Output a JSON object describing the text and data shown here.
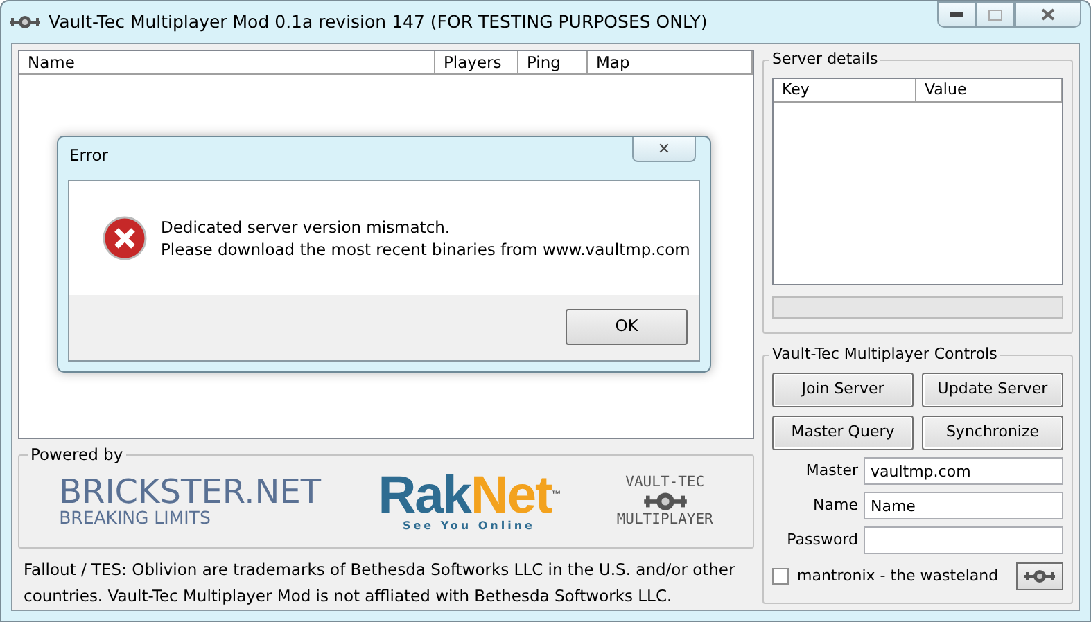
{
  "window": {
    "title": "Vault-Tec Multiplayer Mod 0.1a revision 147 (FOR TESTING PURPOSES ONLY)"
  },
  "server_list": {
    "columns": [
      "Name",
      "Players",
      "Ping",
      "Map"
    ]
  },
  "powered_by": {
    "title": "Powered by",
    "brickster": {
      "name": "BRICKSTER.NET",
      "tagline": "BREAKING LIMITS"
    },
    "raknet": {
      "name_parts": [
        "Rak",
        "Net"
      ],
      "trademark": "™",
      "tagline": "See You Online"
    },
    "vaulttec": {
      "top": "VAULT-TEC",
      "bottom": "MULTIPLAYER"
    }
  },
  "footer": "Fallout / TES: Oblivion are trademarks of Bethesda Softworks LLC in the U.S. and/or other countries. Vault-Tec Multiplayer Mod is not affliated with Bethesda Softworks LLC.",
  "server_details": {
    "title": "Server details",
    "columns": [
      "Key",
      "Value"
    ]
  },
  "controls": {
    "title": "Vault-Tec Multiplayer Controls",
    "buttons": [
      "Join Server",
      "Update Server",
      "Master Query",
      "Synchronize"
    ],
    "fields": [
      {
        "label": "Master",
        "value": "vaultmp.com"
      },
      {
        "label": "Name",
        "value": "Name"
      },
      {
        "label": "Password"
      }
    ],
    "checkbox": {
      "label": "mantronix - the wasteland",
      "checked": false
    }
  },
  "dialog": {
    "title": "Error",
    "close": "✕",
    "lines": [
      "Dedicated server version mismatch.",
      "Please download the most recent binaries from www.vaultmp.com"
    ],
    "button": "OK"
  }
}
